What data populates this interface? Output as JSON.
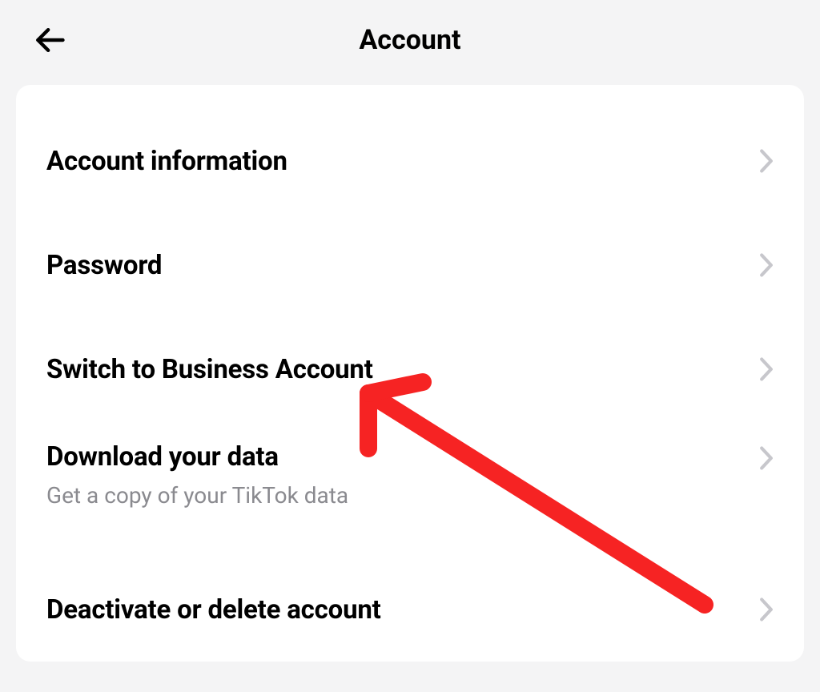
{
  "header": {
    "title": "Account"
  },
  "menu": {
    "items": [
      {
        "label": "Account information",
        "sub": null
      },
      {
        "label": "Password",
        "sub": null
      },
      {
        "label": "Switch to Business Account",
        "sub": null
      },
      {
        "label": "Download your data",
        "sub": "Get a copy of your TikTok data"
      },
      {
        "label": "Deactivate or delete account",
        "sub": null
      }
    ]
  }
}
